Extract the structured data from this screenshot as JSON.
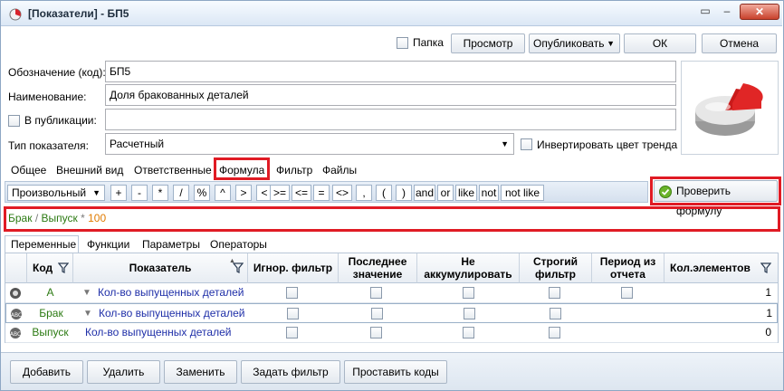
{
  "window": {
    "title": "[Показатели] - БП5"
  },
  "toolbar": {
    "folder_label": "Папка",
    "preview_label": "Просмотр",
    "publish_label": "Опубликовать",
    "ok_label": "ОК",
    "cancel_label": "Отмена"
  },
  "form": {
    "code_label": "Обозначение (код):",
    "code_value": "БП5",
    "name_label": "Наименование:",
    "name_value": "Доля бракованных деталей",
    "publication_label": "В публикации:",
    "publication_value": "",
    "type_label": "Тип показателя:",
    "type_value": "Расчетный",
    "invert_label": "Инвертировать цвет тренда"
  },
  "tabs": [
    "Общее",
    "Внешний вид",
    "Ответственные",
    "Формула",
    "Фильтр",
    "Файлы"
  ],
  "active_tab": "Формула",
  "operators": {
    "mode": "Произвольный",
    "items": [
      "+",
      "-",
      "*",
      "/",
      "%",
      "^",
      ">",
      "<",
      ">=",
      "<=",
      "=",
      "<>",
      ",",
      "(",
      ")",
      "and",
      "or",
      "like",
      "not",
      "not like"
    ],
    "check_formula_label": "Проверить формулу"
  },
  "formula": {
    "left_var": "Брак",
    "op1": " / ",
    "right_var": "Выпуск",
    "op2": " * ",
    "number": "100"
  },
  "subtabs": [
    "Переменные",
    "Функции",
    "Параметры",
    "Операторы"
  ],
  "grid": {
    "headers": {
      "code": "Код",
      "indicator": "Показатель",
      "ignore_filter": "Игнор. фильтр",
      "last_value_1": "Последнее",
      "last_value_2": "значение",
      "not_acc_1": "Не",
      "not_acc_2": "аккумулировать",
      "strict_1": "Строгий",
      "strict_2": "фильтр",
      "period_1": "Период из",
      "period_2": "отчета",
      "count": "Кол.элементов"
    },
    "rows": [
      {
        "code": "А",
        "indicator": "Кол-во выпущенных деталей",
        "count": "1",
        "filtered": true
      },
      {
        "code": "Брак",
        "indicator": "Кол-во выпущенных деталей",
        "count": "1",
        "filtered": true
      },
      {
        "code": "Выпуск",
        "indicator": "Кол-во выпущенных деталей",
        "count": "0",
        "filtered": false
      }
    ]
  },
  "bottom": {
    "add_label": "Добавить",
    "delete_label": "Удалить",
    "replace_label": "Заменить",
    "filter_label": "Задать фильтр",
    "codes_label": "Проставить коды"
  },
  "colors": {
    "accent_red": "#e01b24",
    "var_green": "#2b7a12",
    "link_blue": "#1f2fa8",
    "number_orange": "#e07b00"
  }
}
